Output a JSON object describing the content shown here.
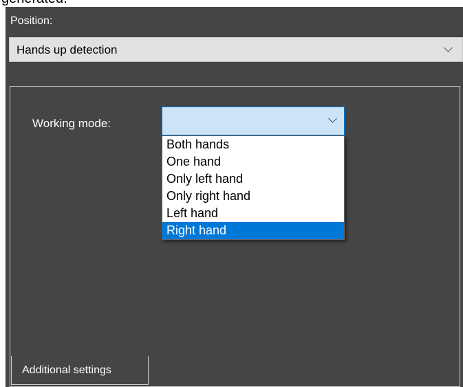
{
  "header_cut_text": "generated.",
  "position": {
    "label": "Position:",
    "selected_value": "Hands up detection"
  },
  "working_mode": {
    "label": "Working mode:",
    "selected_value": "",
    "options": [
      "Both hands",
      "One hand",
      "Only left hand",
      "Only right hand",
      "Left hand",
      "Right hand"
    ],
    "highlighted_option": "Right hand"
  },
  "tabs": {
    "additional_settings": "Additional settings"
  },
  "colors": {
    "panel_bg": "#454545",
    "highlight": "#0078d7",
    "combo_focus_bg": "#cce4f7"
  }
}
